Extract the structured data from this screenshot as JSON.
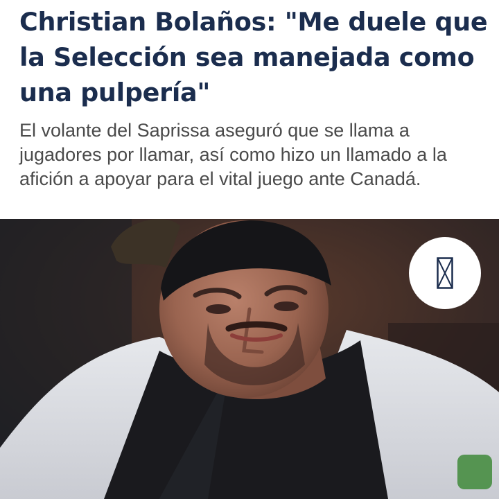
{
  "article": {
    "headline": "Christian Bolaños: \"Me duele que la Selección sea manejada como una pulpería\"",
    "lead": "El volante del Saprissa aseguró que se llama a jugadores por llamar, así como hizo un llamado a la afición a apoyar para el vital juego ante Canadá."
  },
  "photo": {
    "gallery_icon": "image-placeholder-icon"
  },
  "colors": {
    "headline": "#1b2d4e",
    "lead": "#4a4a4a",
    "background": "#ffffff",
    "icon": "#1b2d4e"
  }
}
